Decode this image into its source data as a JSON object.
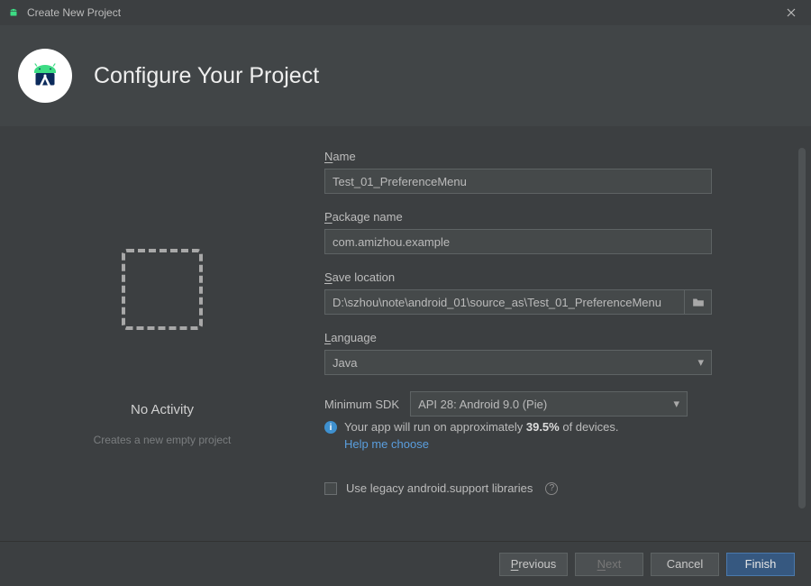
{
  "window": {
    "title": "Create New Project"
  },
  "banner": {
    "heading": "Configure Your Project"
  },
  "preview": {
    "title": "No Activity",
    "subtitle": "Creates a new empty project"
  },
  "form": {
    "name_label": "ame",
    "name_value": "Test_01_PreferenceMenu",
    "package_label": "ackage name",
    "package_value": "com.amizhou.example",
    "save_label": "ave location",
    "save_value": "D:\\szhou\\note\\android_01\\source_as\\Test_01_PreferenceMenu",
    "language_label": "anguage",
    "language_value": "Java",
    "min_sdk_label": "Minimum SDK",
    "min_sdk_value": "API 28: Android 9.0 (Pie)",
    "compat_prefix": "Your app will run on approximately ",
    "compat_pct": "39.5%",
    "compat_suffix": " of devices.",
    "help_link": "Help me choose",
    "legacy_label": "Use legacy android.support libraries"
  },
  "footer": {
    "previous": "revious",
    "next": "ext",
    "cancel": "Cancel",
    "finish": "Finish"
  }
}
